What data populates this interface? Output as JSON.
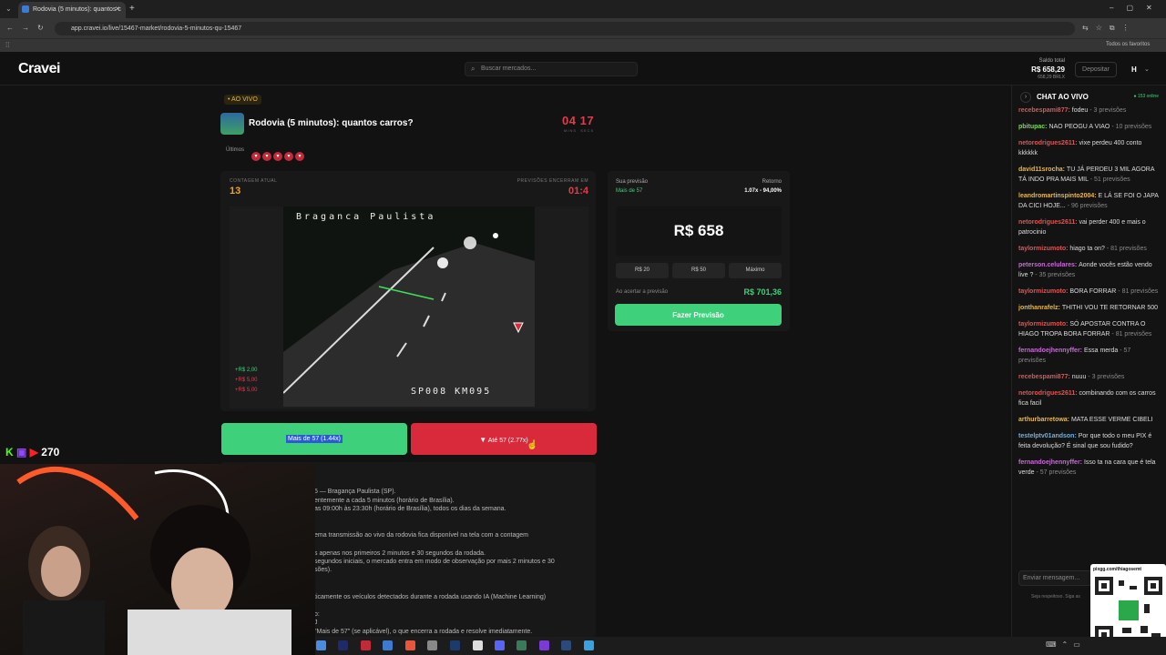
{
  "browser": {
    "tab_title": "Rodovia (5 minutos): quantos c",
    "url": "app.cravei.io/live/15467-market/rodovia-5-minutos-qu-15467",
    "bookmarks_label": "Todos os favoritos"
  },
  "header": {
    "logo": "Cravei",
    "search_placeholder": "Buscar mercados...",
    "balance_label": "Saldo total",
    "balance_value": "R$ 658,29",
    "balance_sub": "658,29 BRLX",
    "deposit_label": "Depositar",
    "avatar_initial": "H"
  },
  "market": {
    "live_badge": "• AO VIVO",
    "title": "Rodovia (5 minutos): quantos carros?",
    "timer_minutes": "04",
    "timer_seconds": "17",
    "timer_min_label": "MINS",
    "timer_sec_label": "SECS",
    "recent_label": "Últimos",
    "count_label": "CONTAGEM ATUAL",
    "count_value": "13",
    "close_label": "PREVISÕES ENCERRAM EM",
    "close_time": "01:4",
    "video_caption_top": "Braganca Paulista",
    "video_caption_bottom": "SP008 KM095",
    "mini_bets": [
      "+R$ 2,00",
      "+R$ 5,00",
      "+R$ 5,00"
    ],
    "btn_mais": "Mais de 57 (1.44x)",
    "btn_ate": "Até 57 (2.77x)"
  },
  "bet": {
    "your_label": "Sua previsão",
    "your_value": "Mais de 57",
    "return_label": "Retorno",
    "return_value": "1.07x - 94,00%",
    "amount": "R$ 658",
    "quick": [
      "R$ 20",
      "R$ 50",
      "Máximo"
    ],
    "payout_label": "Ao acertar a previsão",
    "payout_value": "R$ 701,36",
    "cta": "Fazer Previsão"
  },
  "description": [
    "5 — Bragança Paulista (SP).",
    "entemente a cada 5 minutos (horário de Brasília).",
    "as 09:00h às 23:30h (horário de Brasília), todos os dias da semana.",
    "ema transmissão ao vivo da rodovia fica disponível na tela com a contagem",
    "s apenas nos primeiros 2 minutos e 30 segundos da rodada.",
    "segundos iniciais, o mercado entra em modo de observação por mais 2 minutos e 30",
    "sões).",
    "ticamente os veículos detectados durante a rodada usando IA (Machine Learning)",
    "o:",
    "J",
    "\"Mais de 57\" (se aplicável), o que encerra a rodada e resolve imediatamente."
  ],
  "chat": {
    "title": "CHAT AO VIVO",
    "online": "● 153 online",
    "input_placeholder": "Enviar mensagem...",
    "rules_hint": "Seja respeitoso. Siga as",
    "messages": [
      {
        "user": "recebespami877:",
        "text": "fodeu",
        "meta": " - 3 previsões",
        "color": "#e05555"
      },
      {
        "user": "pbitupac:",
        "text": "NAO PEOGU A VIAO",
        "meta": " - 10 previsões",
        "color": "#7ed957"
      },
      {
        "user": "netorodrigues2611:",
        "text": "vixe perdeu 400 conto kkkkkk",
        "meta": "",
        "color": "#e05555"
      },
      {
        "user": "david11srocha:",
        "text": "TU JÁ PERDEU 3 MIL AGORA TÁ INDO PRA MAIS MIL",
        "meta": " - 51 previsões",
        "color": "#e8b84a"
      },
      {
        "user": "leandromartinspinto2004:",
        "text": "E LÁ SE FOI O JAPA DA CICI HOJE...",
        "meta": " - 96 previsões",
        "color": "#e8b84a"
      },
      {
        "user": "netorodrigues2611:",
        "text": "vai perder 400 e mais o patrocinio",
        "meta": "",
        "color": "#e05555"
      },
      {
        "user": "taylormizumoto:",
        "text": "hiago ta on?",
        "meta": " - 81 previsões",
        "color": "#e05555"
      },
      {
        "user": "peterson.celulares:",
        "text": "Aonde vocês estão vendo live ?",
        "meta": " - 35 previsões",
        "color": "#c86bd6"
      },
      {
        "user": "taylormizumoto:",
        "text": "BORA FORRAR",
        "meta": " - 81 previsões",
        "color": "#e05555"
      },
      {
        "user": "jonthanrafelz:",
        "text": "THITHI VOU TE RETORNAR 500",
        "meta": "",
        "color": "#e8b84a"
      },
      {
        "user": "taylormizumoto:",
        "text": "SÓ APOSTAR CONTRA O HIAGO TROPA BORA FORRAR",
        "meta": " - 81 previsões",
        "color": "#e05555"
      },
      {
        "user": "fernandoejhennyffer:",
        "text": "Essa merda",
        "meta": " - 57 previsões",
        "color": "#c86bd6"
      },
      {
        "user": "recebespami877:",
        "text": "nuuu",
        "meta": " - 3 previsões",
        "color": "#e05555"
      },
      {
        "user": "netorodrigues2611:",
        "text": "combinando com os carros fica facil",
        "meta": "",
        "color": "#e05555"
      },
      {
        "user": "arthurbarretowa:",
        "text": "MATA ESSE VERME CIBELI",
        "meta": "",
        "color": "#e8b84a"
      },
      {
        "user": "testelptv01andson:",
        "text": "Por que todo o meu PIX é feita devolução? É sinal que sou fudido?",
        "meta": "",
        "color": "#6bb2e8"
      },
      {
        "user": "fernandoejhennyffer:",
        "text": "Isso ta na cara que é tela verde",
        "meta": " - 57 previsões",
        "color": "#c86bd6"
      }
    ]
  },
  "stream": {
    "viewer_count": "270",
    "qr_label": "pixgg.com/thiagosemt"
  }
}
